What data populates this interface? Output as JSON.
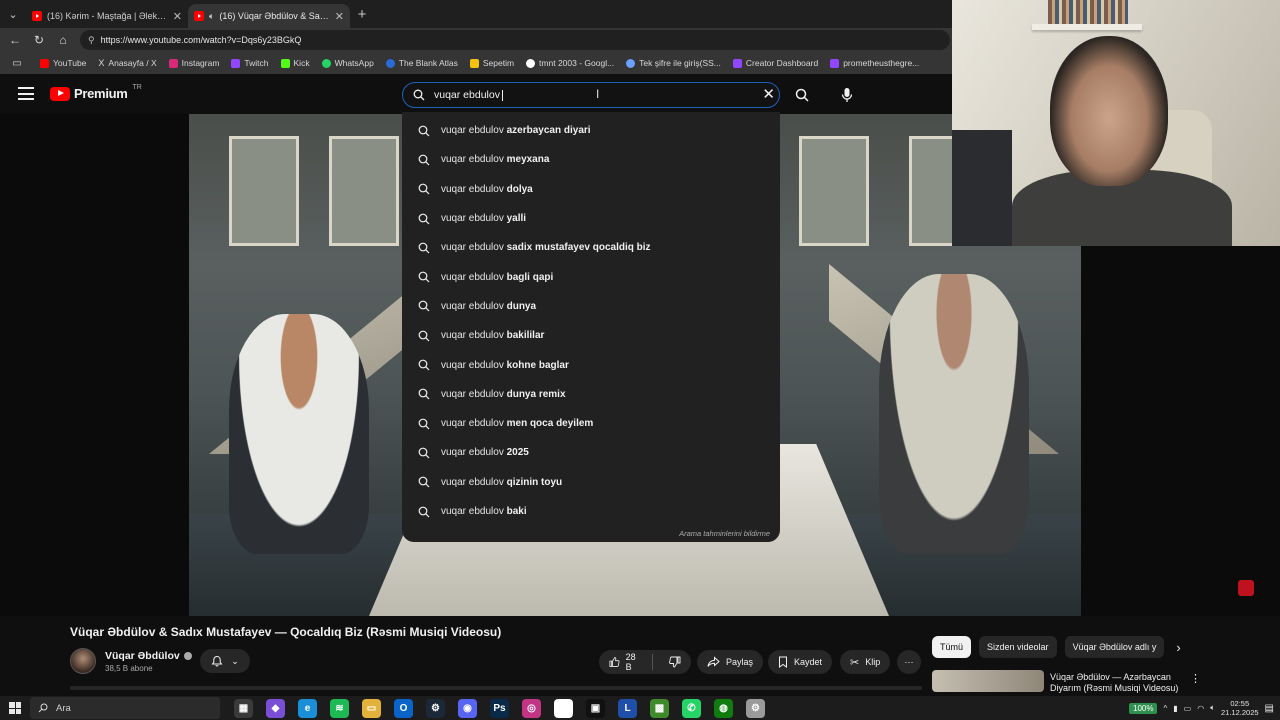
{
  "browser": {
    "tabs": [
      {
        "title": "(16) Kərim - Maştağa | Əlekbər N...",
        "active": false
      },
      {
        "title": "(16) Vüqar Əbdülov & Sadıx M...",
        "active": true
      }
    ],
    "new_tab_label": "+",
    "url": "https://www.youtube.com/watch?v=Dqs6y23BGkQ",
    "bookmarks": [
      {
        "label": "YouTube",
        "color": "#ff0000"
      },
      {
        "label": "Anasayfa / X",
        "color": "#000000"
      },
      {
        "label": "Instagram",
        "color": "#d62976"
      },
      {
        "label": "Twitch",
        "color": "#9146ff"
      },
      {
        "label": "Kick",
        "color": "#53fc18"
      },
      {
        "label": "WhatsApp",
        "color": "#25d366"
      },
      {
        "label": "The Blank Atlas",
        "color": "#2a6bd8"
      },
      {
        "label": "Sepetim",
        "color": "#f4c20d"
      },
      {
        "label": "tmnt 2003 - Googl...",
        "color": "#ffffff"
      },
      {
        "label": "Tek şifre ile giriş(SS...",
        "color": "#6aa0ff"
      },
      {
        "label": "Creator Dashboard",
        "color": "#9146ff"
      },
      {
        "label": "prometheusthegre...",
        "color": "#9146ff"
      }
    ]
  },
  "youtube": {
    "logo_text": "Premium",
    "logo_region": "TR",
    "search": {
      "value": "vuqar ebdulov",
      "typed": "vuqar ebdulov ",
      "suggestions": [
        {
          "prefix": "vuqar ebdulov",
          "suffix": "azerbaycan diyari"
        },
        {
          "prefix": "vuqar ebdulov",
          "suffix": "meyxana"
        },
        {
          "prefix": "vuqar ebdulov",
          "suffix": "dolya"
        },
        {
          "prefix": "vuqar ebdulov",
          "suffix": "yalli"
        },
        {
          "prefix": "vuqar ebdulov",
          "suffix": "sadix mustafayev qocaldiq biz"
        },
        {
          "prefix": "vuqar ebdulov",
          "suffix": "bagli qapi"
        },
        {
          "prefix": "vuqar ebdulov",
          "suffix": "dunya"
        },
        {
          "prefix": "vuqar ebdulov",
          "suffix": "bakililar"
        },
        {
          "prefix": "vuqar ebdulov",
          "suffix": "kohne baglar"
        },
        {
          "prefix": "vuqar ebdulov",
          "suffix": "dunya remix"
        },
        {
          "prefix": "vuqar ebdulov",
          "suffix": "men qoca deyilem"
        },
        {
          "prefix": "vuqar ebdulov",
          "suffix": "2025"
        },
        {
          "prefix": "vuqar ebdulov",
          "suffix": "qizinin toyu"
        },
        {
          "prefix": "vuqar ebdulov",
          "suffix": "baki"
        }
      ],
      "report_text": "Arama tahminlerini bildirme"
    },
    "video": {
      "title": "Vüqar Əbdülov & Sadıx Mustafayev — Qocaldıq Biz (Rəsmi Musiqi Videosu)",
      "channel_name": "Vüqar Əbdülov",
      "subscribers": "38,5 B abone",
      "likes": "28 B",
      "share_label": "Paylaş",
      "save_label": "Kaydet",
      "clip_label": "Klip",
      "more_label": "⋯"
    },
    "chips": [
      {
        "label": "Tümü",
        "active": true
      },
      {
        "label": "Sizden videolar",
        "active": false
      },
      {
        "label": "Vüqar Əbdülov adlı y",
        "active": false
      }
    ],
    "recommended": {
      "title": "Vüqar Əbdülov — Azərbaycan Diyarım (Rəsmi Musiqi Videosu)"
    }
  },
  "taskbar": {
    "search_placeholder": "Ara",
    "zoom": "100%",
    "time": "02:55",
    "date": "21.12.2025",
    "apps": [
      {
        "name": "task-view",
        "color": "#3a3a3a",
        "glyph": "▦"
      },
      {
        "name": "copilot",
        "color": "#7a4fd6",
        "glyph": "◆"
      },
      {
        "name": "edge",
        "color": "#1a8fd8",
        "glyph": "e"
      },
      {
        "name": "spotify",
        "color": "#1db954",
        "glyph": "≋"
      },
      {
        "name": "file-explorer",
        "color": "#e2b23a",
        "glyph": "▭"
      },
      {
        "name": "outlook",
        "color": "#0a64c8",
        "glyph": "O"
      },
      {
        "name": "steam",
        "color": "#1b2838",
        "glyph": "⚙"
      },
      {
        "name": "discord",
        "color": "#5865f2",
        "glyph": "◉"
      },
      {
        "name": "photoshop",
        "color": "#0a2a4a",
        "glyph": "Ps"
      },
      {
        "name": "instagram",
        "color": "#c13584",
        "glyph": "◎"
      },
      {
        "name": "notepad",
        "color": "#ffffff",
        "glyph": " "
      },
      {
        "name": "capcut",
        "color": "#111111",
        "glyph": "▣"
      },
      {
        "name": "lens-app",
        "color": "#1f4fa8",
        "glyph": "L"
      },
      {
        "name": "minecraft",
        "color": "#3f8a2b",
        "glyph": "▩"
      },
      {
        "name": "whatsapp",
        "color": "#25d366",
        "glyph": "✆"
      },
      {
        "name": "xbox-app",
        "color": "#107c10",
        "glyph": "◍"
      },
      {
        "name": "settings",
        "color": "#9a9a9a",
        "glyph": "⚙"
      }
    ]
  }
}
